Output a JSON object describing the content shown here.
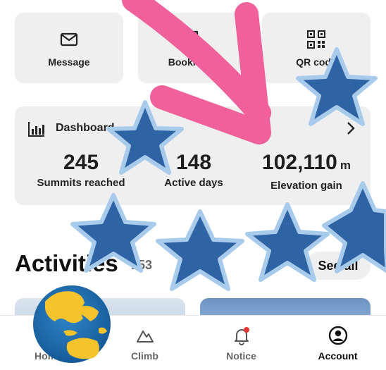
{
  "quick_actions": [
    {
      "label": "Message",
      "icon": "envelope-icon"
    },
    {
      "label": "Bookmark",
      "icon": "bookmark-icon"
    },
    {
      "label": "QR code",
      "icon": "qr-code-icon"
    }
  ],
  "dashboard": {
    "title": "Dashboard",
    "stats": [
      {
        "value": "245",
        "unit": "",
        "caption": "Summits reached"
      },
      {
        "value": "148",
        "unit": "",
        "caption": "Active days"
      },
      {
        "value": "102,110",
        "unit": "m",
        "caption": "Elevation gain"
      }
    ]
  },
  "activities": {
    "title": "Activities",
    "count": "153",
    "see_all": "See all"
  },
  "tabs": [
    {
      "label": "Home",
      "icon": "home-icon"
    },
    {
      "label": "Climb",
      "icon": "mountain-icon"
    },
    {
      "label": "Notice",
      "icon": "bell-icon"
    },
    {
      "label": "Account",
      "icon": "user-icon"
    }
  ],
  "colors": {
    "arrow": "#f0609a",
    "star_fill": "#2e64a4",
    "star_outline": "#a8cbec",
    "globe_ocean": "#1f6eb0",
    "globe_land": "#f5c32c"
  }
}
